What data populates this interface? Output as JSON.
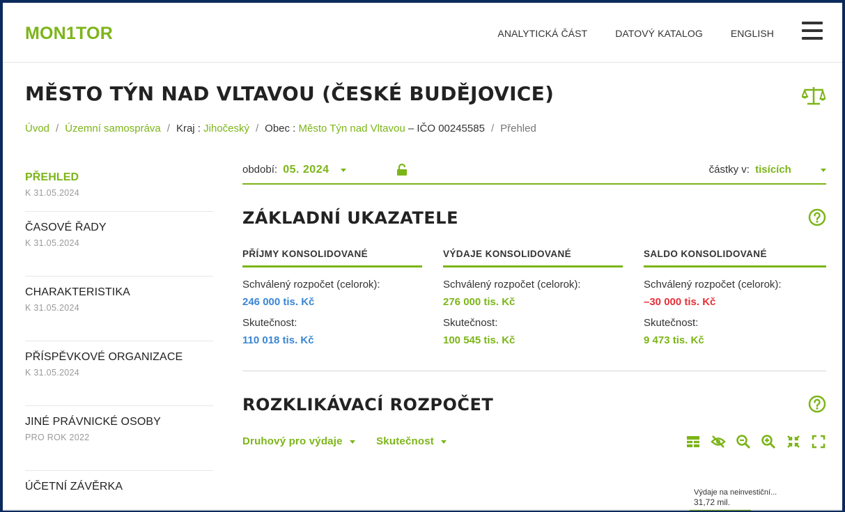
{
  "header": {
    "logo": "MON1TOR",
    "nav": [
      "ANALYTICKÁ ČÁST",
      "DATOVÝ KATALOG",
      "ENGLISH"
    ]
  },
  "page": {
    "title": "MĚSTO TÝN NAD VLTAVOU (ČESKÉ BUDĚJOVICE)"
  },
  "breadcrumb": {
    "home": "Úvod",
    "sector": "Územní samospráva",
    "region_label": "Kraj :",
    "region": "Jihočeský",
    "municipality_label": "Obec :",
    "municipality": "Město Týn nad Vltavou",
    "ico": "– IČO 00245585",
    "current": "Přehled"
  },
  "sidebar": {
    "items": [
      {
        "label": "PŘEHLED",
        "sub": "K 31.05.2024"
      },
      {
        "label": "ČASOVÉ ŘADY",
        "sub": "K 31.05.2024"
      },
      {
        "label": "CHARAKTERISTIKA",
        "sub": "K 31.05.2024"
      },
      {
        "label": "PŘÍSPĚVKOVÉ ORGANIZACE",
        "sub": "K 31.05.2024"
      },
      {
        "label": "JINÉ PRÁVNICKÉ OSOBY",
        "sub": "PRO ROK 2022"
      },
      {
        "label": "ÚČETNÍ ZÁVĚRKA",
        "sub": ""
      }
    ]
  },
  "period": {
    "label": "období:",
    "value": "05. 2024",
    "amount_label": "částky v:",
    "amount_value": "tisících"
  },
  "basic": {
    "title": "ZÁKLADNÍ UKAZATELE",
    "columns": [
      {
        "head": "PŘÍJMY KONSOLIDOVANÉ",
        "budget_label": "Schválený rozpočet (celorok):",
        "budget": "246 000 tis. Kč",
        "actual_label": "Skutečnost:",
        "actual": "110 018 tis. Kč"
      },
      {
        "head": "VÝDAJE KONSOLIDOVANÉ",
        "budget_label": "Schválený rozpočet (celorok):",
        "budget": "276 000 tis. Kč",
        "actual_label": "Skutečnost:",
        "actual": "100 545 tis. Kč"
      },
      {
        "head": "SALDO KONSOLIDOVANÉ",
        "budget_label": "Schválený rozpočet (celorok):",
        "budget": "–30 000 tis. Kč",
        "actual_label": "Skutečnost:",
        "actual": "9 473 tis. Kč"
      }
    ]
  },
  "budget": {
    "title": "ROZKLIKÁVACÍ ROZPOČET",
    "filter1": "Druhový pro výdaje",
    "filter2": "Skutečnost",
    "node_label": "Výdaje na neinvestiční...",
    "node_value": "31,72 mil."
  },
  "colors": {
    "accent": "#7cb518",
    "income": "#3a86d4",
    "negative": "#e8303a"
  }
}
